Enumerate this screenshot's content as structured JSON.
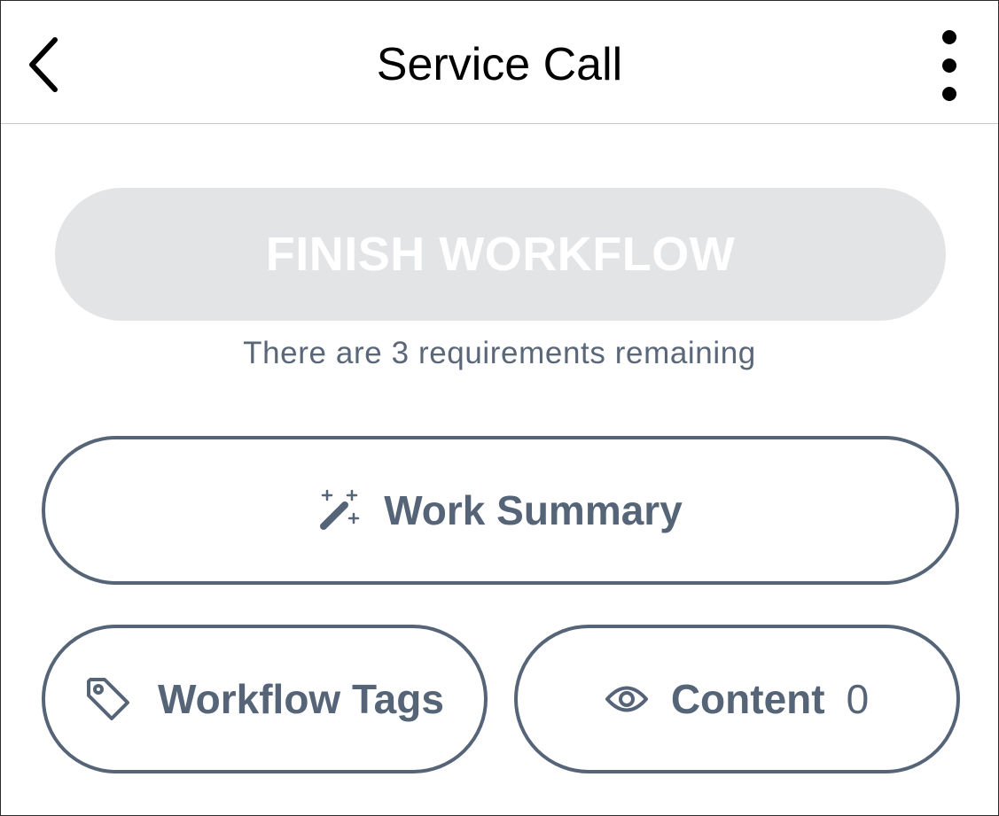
{
  "header": {
    "title": "Service Call",
    "back_icon": "chevron-left-icon",
    "menu_icon": "more-vertical-icon"
  },
  "finish": {
    "label": "FINISH WORKFLOW",
    "status": "There are 3 requirements remaining",
    "disabled": true
  },
  "actions": {
    "work_summary": {
      "label": "Work Summary",
      "icon": "magic-wand-icon"
    },
    "workflow_tags": {
      "label": "Workflow Tags",
      "icon": "tag-icon"
    },
    "content": {
      "label": "Content",
      "count": "0",
      "icon": "eye-icon"
    }
  },
  "colors": {
    "accent": "#556477",
    "disabled_bg": "#e3e4e6",
    "text_secondary": "#5a6779"
  }
}
